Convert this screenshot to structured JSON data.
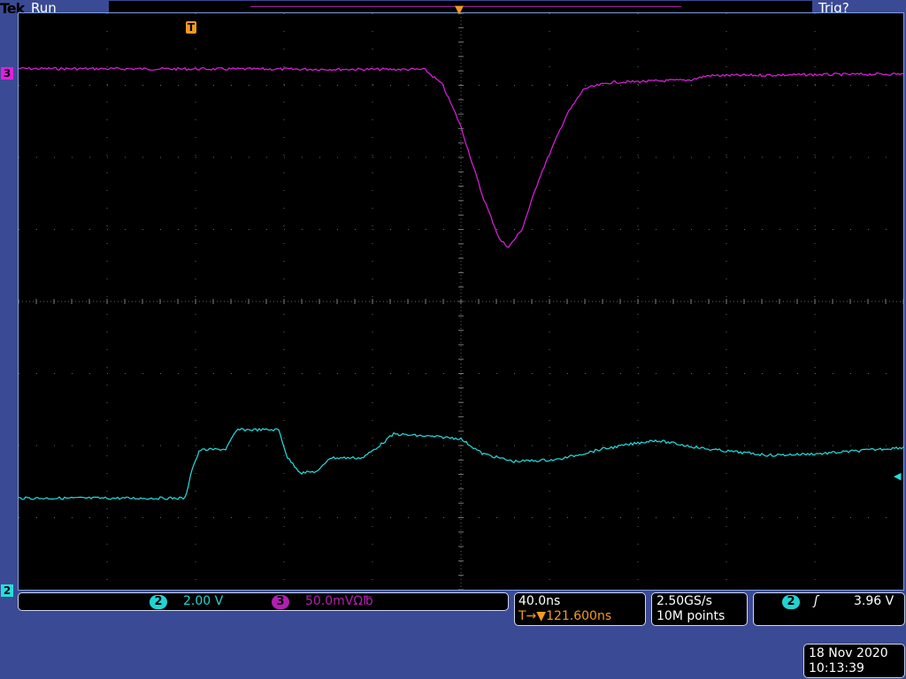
{
  "header": {
    "brand": "Tek",
    "state": "Run",
    "trigger_status": "Trig?"
  },
  "markers": {
    "ch3": "3",
    "ch2": "2",
    "trigger": "T"
  },
  "vertical": {
    "ch2": {
      "badge": "2",
      "scale": "2.00 V",
      "color": "#22d3d3"
    },
    "ch3": {
      "badge": "3",
      "scale": "50.0mVΩ℔",
      "color": "#b020b0"
    }
  },
  "horizontal": {
    "scale": "40.0ns",
    "delay": "121.600ns",
    "delay_icon": "T→▼"
  },
  "acquisition": {
    "rate": "2.50GS/s",
    "length": "10M points"
  },
  "trigger": {
    "badge": "2",
    "slope_icon": "rising-edge",
    "slope_glyph": "ʃ",
    "level": "3.96 V"
  },
  "datetime": {
    "date": "18 Nov 2020",
    "time": "10:13:39"
  },
  "chart_data": {
    "type": "line",
    "x_unit": "ns",
    "x_range": [
      -200,
      200
    ],
    "series": [
      {
        "name": "Ch3",
        "unit": "mV",
        "color": "#e020e0",
        "volts_per_div": 0.05,
        "points": [
          [
            -200,
            161.6
          ],
          [
            -16.4,
            161
          ],
          [
            -8.4,
            150.6
          ],
          [
            -0.4,
            123
          ],
          [
            9.6,
            74
          ],
          [
            17.6,
            42.7
          ],
          [
            21.6,
            37.8
          ],
          [
            27.6,
            50
          ],
          [
            35.6,
            86.6
          ],
          [
            47.6,
            129
          ],
          [
            55.6,
            147.6
          ],
          [
            67.6,
            152
          ],
          [
            103.6,
            153.7
          ],
          [
            111.6,
            156.7
          ],
          [
            200,
            157.9
          ]
        ]
      },
      {
        "name": "Ch2",
        "unit": "V",
        "color": "#22e0e0",
        "volts_per_div": 2,
        "points": [
          [
            -200,
            -5.46
          ],
          [
            -124.4,
            -5.46
          ],
          [
            -122,
            -4.71
          ],
          [
            -118,
            -4.12
          ],
          [
            -106.4,
            -4.1
          ],
          [
            -101.2,
            -3.56
          ],
          [
            -82.4,
            -3.56
          ],
          [
            -78.4,
            -4.34
          ],
          [
            -72.4,
            -4.76
          ],
          [
            -64.4,
            -4.71
          ],
          [
            -59.6,
            -4.34
          ],
          [
            -44.4,
            -4.34
          ],
          [
            -36.4,
            -3.98
          ],
          [
            -30.4,
            -3.68
          ],
          [
            -0.4,
            -3.8
          ],
          [
            9.6,
            -4.22
          ],
          [
            23.6,
            -4.44
          ],
          [
            43.6,
            -4.39
          ],
          [
            63.6,
            -4.1
          ],
          [
            87.6,
            -3.85
          ],
          [
            111.6,
            -4.1
          ],
          [
            139.6,
            -4.27
          ],
          [
            163.6,
            -4.22
          ],
          [
            200,
            -4.05
          ]
        ]
      }
    ]
  }
}
